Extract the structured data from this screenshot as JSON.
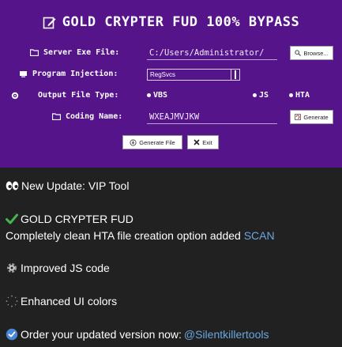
{
  "app": {
    "title": "GOLD CRYPTER FUD 100% BYPASS",
    "server_exe_label": "Server Exe File:",
    "server_exe_value": "C:/Users/Administrator/",
    "browse_label": "Browse...",
    "program_injection_label": "Program Injection:",
    "program_injection_value": "RegSvcs",
    "output_type_label": "Output File Type:",
    "output_options": [
      "VBS",
      "JS",
      "HTA"
    ],
    "coding_name_label": "Coding Name:",
    "coding_name_value": "WXEAJMVJKW",
    "generate_label": "Generate",
    "generate_file_label": "Generate File",
    "exit_label": "Exit"
  },
  "message": {
    "line1": "New Update: VIP Tool",
    "line2": "GOLD CRYPTER FUD",
    "line3_text": "Completely clean HTA file creation option added",
    "line3_link": "SCAN",
    "line4": "Improved JS code",
    "line5": "Enhanced UI colors",
    "line6_text": "Order your updated version now:",
    "line6_link": "@Silentkillertools"
  },
  "colors": {
    "panel_bg": "#55148a",
    "page_bg": "#212121",
    "link": "#6aa6e0",
    "check": "#45b649"
  }
}
